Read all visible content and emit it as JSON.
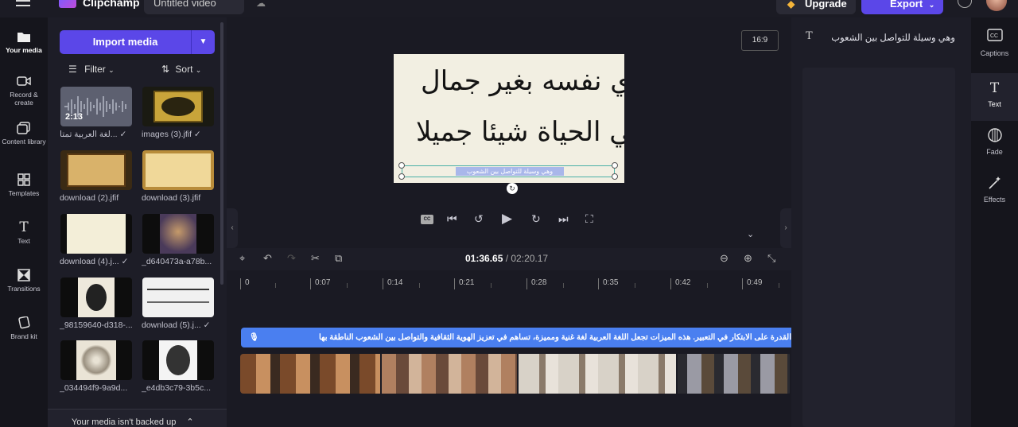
{
  "app": {
    "name": "Clipchamp",
    "project_title": "Untitled video",
    "upgrade_label": "Upgrade",
    "export_label": "Export"
  },
  "left_nav": [
    {
      "label": "Your media",
      "icon": "folder-icon"
    },
    {
      "label": "Record & create",
      "icon": "camera-icon"
    },
    {
      "label": "Content library",
      "icon": "library-icon"
    },
    {
      "label": "Templates",
      "icon": "templates-icon"
    },
    {
      "label": "Text",
      "icon": "text-icon"
    },
    {
      "label": "Transitions",
      "icon": "transitions-icon"
    },
    {
      "label": "Brand kit",
      "icon": "brand-kit-icon"
    }
  ],
  "media": {
    "import_label": "Import media",
    "filter_label": "Filter",
    "sort_label": "Sort",
    "backup_notice": "Your media isn't backed up",
    "items": [
      {
        "label": "لغة العربية تمتا...",
        "duration": "2:13",
        "used": true
      },
      {
        "label": "images (3).jfif",
        "used": true
      },
      {
        "label": "download (2).jfif",
        "used": false
      },
      {
        "label": "download (3).jfif",
        "used": false
      },
      {
        "label": "download (4).j...",
        "used": true
      },
      {
        "label": "_d640473a-a78b...",
        "used": false
      },
      {
        "label": "_98159640-d318-...",
        "used": false
      },
      {
        "label": "download (5).j...",
        "used": true
      },
      {
        "label": "_034494f9-9a9d...",
        "used": false
      },
      {
        "label": "_e4db3c79-3b5c...",
        "used": false
      }
    ]
  },
  "preview": {
    "aspect_ratio": "16:9",
    "calligraphy_line1": "والذي نفسه بغير جمال",
    "calligraphy_line2": "لا يرى في الحياة شيئا جميلا",
    "subtitle_text": "وهي وسيلة للتواصل بين الشعوب"
  },
  "timeline": {
    "current_time": "01:36.65",
    "total_time": "/ 02:20.17",
    "ruler_labels": [
      "0",
      "0:07",
      "0:14",
      "0:21",
      "0:28",
      "0:35",
      "0:42",
      "0:49"
    ],
    "caption_text": "القدرة على الابتكار في التعبير. هذه الميزات تجعل اللغة العربية لغة غنية ومميزة، تساهم في تعزيز الهوية الثقافية والتواصل بين الشعوب الناطقة بها"
  },
  "properties": {
    "text_value": "وهي وسيلة للتواصل بين الشعوب"
  },
  "right_tabs": [
    {
      "label": "Captions",
      "icon": "captions-icon",
      "active": false
    },
    {
      "label": "Text",
      "icon": "text-icon",
      "active": true
    },
    {
      "label": "Fade",
      "icon": "fade-icon",
      "active": false
    },
    {
      "label": "Effects",
      "icon": "effects-icon",
      "active": false
    }
  ]
}
